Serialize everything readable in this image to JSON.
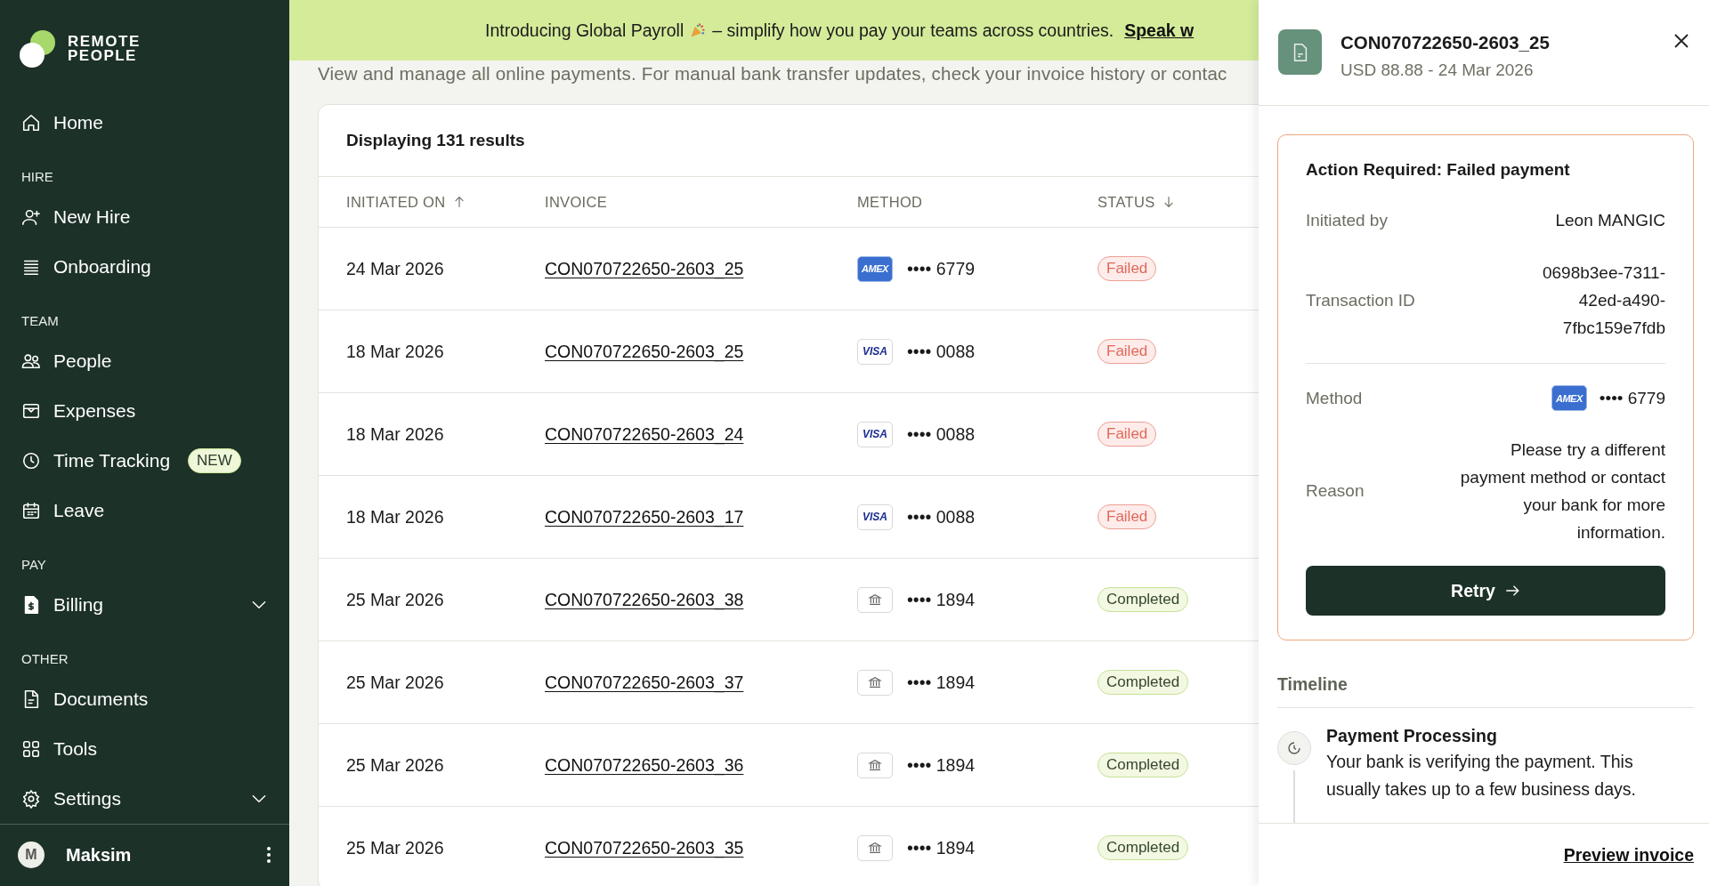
{
  "sidebar": {
    "logo": {
      "lines": [
        "REMOTE",
        "PEOPLE"
      ]
    },
    "sections": [
      {
        "items": [
          {
            "label": "Home",
            "expandable": false
          }
        ]
      },
      {
        "heading": "HIRE",
        "items": [
          {
            "label": "New Hire",
            "expandable": false
          },
          {
            "label": "Onboarding",
            "expandable": false
          }
        ]
      },
      {
        "heading": "TEAM",
        "items": [
          {
            "label": "People",
            "expandable": false
          },
          {
            "label": "Expenses",
            "expandable": false
          },
          {
            "label": "Time Tracking",
            "badge": "NEW",
            "expandable": false
          },
          {
            "label": "Leave",
            "expandable": false
          }
        ]
      },
      {
        "heading": "PAY",
        "items": [
          {
            "label": "Billing",
            "expandable": true
          }
        ]
      },
      {
        "heading": "OTHER",
        "items": [
          {
            "label": "Documents",
            "expandable": false
          },
          {
            "label": "Tools",
            "expandable": false
          },
          {
            "label": "Settings",
            "expandable": true
          }
        ]
      }
    ],
    "user": {
      "initial": "M",
      "name": "Maksim"
    }
  },
  "banner": {
    "text_before": "Introducing Global Payroll",
    "text_after": "– simplify how you pay your teams across countries.",
    "link": "Speak w"
  },
  "subtitle": "View and manage all online payments. For manual bank transfer updates, check your invoice history or contac",
  "table": {
    "summary": "Displaying 131 results",
    "columns": [
      {
        "label": "INITIATED ON",
        "kind": "ascending"
      },
      {
        "label": "INVOICE",
        "kind": "plain"
      },
      {
        "label": "METHOD",
        "kind": "plain"
      },
      {
        "label": "STATUS",
        "kind": "descending"
      }
    ],
    "rows": [
      {
        "date": "24 Mar 2026",
        "invoice": "CON070722650-2603_25",
        "method": {
          "kind": "amex",
          "brand": "AMEX",
          "digits": "•••• 6779"
        },
        "status": {
          "kind": "failed",
          "label": "Failed"
        }
      },
      {
        "date": "18 Mar 2026",
        "invoice": "CON070722650-2603_25",
        "method": {
          "kind": "visa",
          "brand": "VISA",
          "digits": "•••• 0088"
        },
        "status": {
          "kind": "failed",
          "label": "Failed"
        }
      },
      {
        "date": "18 Mar 2026",
        "invoice": "CON070722650-2603_24",
        "method": {
          "kind": "visa",
          "brand": "VISA",
          "digits": "•••• 0088"
        },
        "status": {
          "kind": "failed",
          "label": "Failed"
        }
      },
      {
        "date": "18 Mar 2026",
        "invoice": "CON070722650-2603_17",
        "method": {
          "kind": "visa",
          "brand": "VISA",
          "digits": "•••• 0088"
        },
        "status": {
          "kind": "failed",
          "label": "Failed"
        }
      },
      {
        "date": "25 Mar 2026",
        "invoice": "CON070722650-2603_38",
        "method": {
          "kind": "bank",
          "digits": "•••• 1894"
        },
        "status": {
          "kind": "completed",
          "label": "Completed"
        }
      },
      {
        "date": "25 Mar 2026",
        "invoice": "CON070722650-2603_37",
        "method": {
          "kind": "bank",
          "digits": "•••• 1894"
        },
        "status": {
          "kind": "completed",
          "label": "Completed"
        }
      },
      {
        "date": "25 Mar 2026",
        "invoice": "CON070722650-2603_36",
        "method": {
          "kind": "bank",
          "digits": "•••• 1894"
        },
        "status": {
          "kind": "completed",
          "label": "Completed"
        }
      },
      {
        "date": "25 Mar 2026",
        "invoice": "CON070722650-2603_35",
        "method": {
          "kind": "bank",
          "digits": "•••• 1894"
        },
        "status": {
          "kind": "completed",
          "label": "Completed"
        }
      }
    ]
  },
  "panel": {
    "title": "CON070722650-2603_25",
    "subtitle": "USD 88.88 - 24 Mar 2026",
    "alert": {
      "title": "Action Required: Failed payment",
      "fields": [
        {
          "kind": "text",
          "label": "Initiated by",
          "value": "Leon MANGIC"
        },
        {
          "kind": "text",
          "label": "Transaction ID",
          "value": "0698b3ee-7311-42ed-a490-7fbc159e7fdb"
        },
        {
          "kind": "method",
          "label": "Method",
          "method": {
            "kind": "amex",
            "brand": "AMEX",
            "digits": "•••• 6779"
          }
        },
        {
          "kind": "text",
          "label": "Reason",
          "value": "Please try a different payment method or contact your bank for more information."
        }
      ],
      "button": "Retry"
    },
    "timeline": {
      "heading": "Timeline",
      "items": [
        {
          "title": "Payment Processing",
          "description": "Your bank is verifying the payment. This usually takes up to a few business days."
        }
      ]
    },
    "footer_link": "Preview invoice"
  }
}
